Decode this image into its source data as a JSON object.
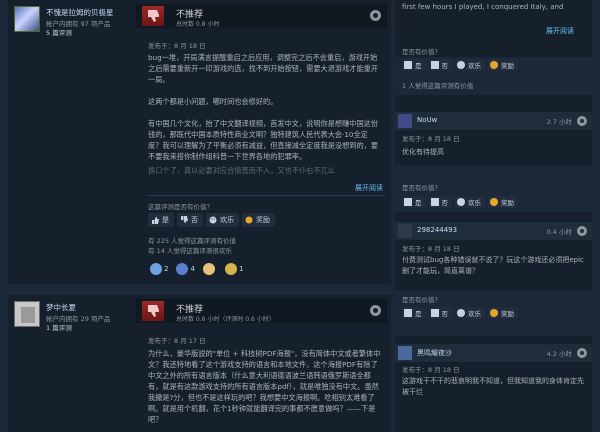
{
  "review1": {
    "author_name": "不愧是拉姆的贝极星",
    "author_products": "帐户内拥有 97 项产品",
    "author_reviews": "5 篇评测",
    "verdict": "不推荐",
    "hours": "总时数 0.8 小时",
    "posted": "发布于：8 月 18 日",
    "paragraphs": [
      "bug一堆，开局满言提醒重启之后应用，调整完之后不会重启，游戏开始之后需要重新开一印游戏的选，找不到开始按钮，需要大退游戏才能重开一局。",
      "这两个都是小问题，嘟时间也会修好的。",
      "有中国几个文化，抬了中文翻译视频，首发中文，说明你是想赚中国这份钱的，那既代中国本质特性商业文明？独特建筑人民代表大会·10全定度？我可以理解为了平衡必须有减益，但直接减全定度我是没想到的，要不要我来搭你制作组科普一下世界各地的犯罪率。"
    ],
    "faded": "换口个了，真以必要对应合情普而不入，又也不仆右不兀么",
    "read_more": "展开阅读",
    "helpful_q": "这篇评测是否有价值？",
    "btn_yes": "是",
    "btn_no": "否",
    "btn_funny": "欢乐",
    "btn_award": "奖励",
    "stat_helpful": "有 225 人觉得这篇评测有价值",
    "stat_funny": "有 14 人觉得这篇评测很欢乐",
    "awards": [
      {
        "icon": "award-icon-1",
        "count": "2"
      },
      {
        "icon": "award-icon-2",
        "count": "4"
      },
      {
        "icon": "award-icon-3",
        "count": ""
      },
      {
        "icon": "award-icon-4",
        "count": "1"
      }
    ]
  },
  "review2": {
    "author_name": "梦中长夏",
    "author_products": "帐户内拥有 29 项产品",
    "author_reviews": "1 篇评测",
    "verdict": "不推荐",
    "hours": "总时数 0.6 小时（评测时 0.6 小时）",
    "posted": "发布于：8 月 17 日",
    "paragraphs": [
      "为什么，豪华版説的\"单位 + 科技树PDF海报\"，没有简体中文或者繁体中文？我还特地看了这个游戏支持的语言和本地文件，这个海报PDF有除了中文之外的所有语言版本（什么意大利语德语波兰语韩语俄罗斯语全都有，就是有这款游戏支持的所有语言版本pdf），就是唯独没有中文。虽然我撒是?分，但也不是这样玩的吧？我想要中文海报啊。吃相别太难看了啊。就是用个机翻，花个1秒钟就能翻译完的事都不愿意做吗？——下是吧？"
    ]
  },
  "side": {
    "top_text": "first few hours I played, I conquered Italy, and",
    "read_more": "展开阅读",
    "helpful_q": "是否有价值？",
    "btn_yes": "是",
    "btn_no": "否",
    "btn_funny": "欢乐",
    "btn_award": "奖励",
    "stat1": "1 人觉得这篇评测有价值",
    "card1": {
      "user": "NoUw",
      "hours": "2.7 小时",
      "posted": "发布于：8 月 18 日",
      "text": "优化有待提高"
    },
    "card2": {
      "user": "298244493",
      "hours": "0.4 小时",
      "posted": "发布于：8 月 18 日",
      "text": "付费测试bug各种错误就不说了？玩这个游戏还必须把epic删了才能玩，简直离谱？"
    },
    "card3": {
      "user": "黑鸣耀夜沙",
      "hours": "4.2 小时",
      "posted": "发布于：8 月 18 日",
      "text": "这游戏干不干的悲哀明我不知道，但我知道我的身体肯定先被干烂"
    }
  }
}
